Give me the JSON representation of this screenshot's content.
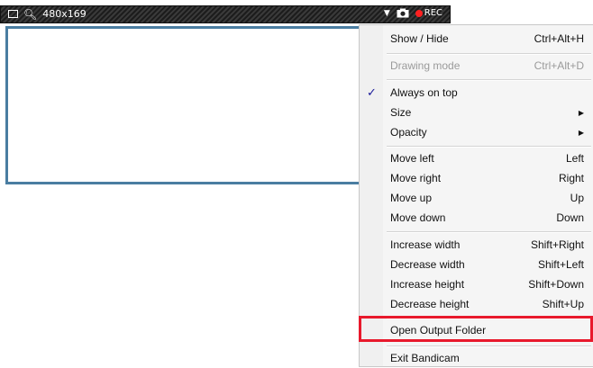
{
  "toolbar": {
    "size_label": "480x169",
    "rec_label": "REC",
    "icons": [
      "window-icon",
      "search-icon",
      "dropdown-arrow-icon",
      "camera-icon",
      "record-dot-icon"
    ]
  },
  "menu": {
    "show_hide": {
      "label": "Show / Hide",
      "shortcut": "Ctrl+Alt+H"
    },
    "drawing_mode": {
      "label": "Drawing mode",
      "shortcut": "Ctrl+Alt+D"
    },
    "always_on_top": {
      "label": "Always on top",
      "checked": true,
      "check": "✓"
    },
    "size": {
      "label": "Size",
      "arrow": "▶"
    },
    "opacity": {
      "label": "Opacity",
      "arrow": "▶"
    },
    "move_left": {
      "label": "Move left",
      "shortcut": "Left"
    },
    "move_right": {
      "label": "Move right",
      "shortcut": "Right"
    },
    "move_up": {
      "label": "Move up",
      "shortcut": "Up"
    },
    "move_down": {
      "label": "Move down",
      "shortcut": "Down"
    },
    "increase_width": {
      "label": "Increase width",
      "shortcut": "Shift+Right"
    },
    "decrease_width": {
      "label": "Decrease width",
      "shortcut": "Shift+Left"
    },
    "increase_height": {
      "label": "Increase height",
      "shortcut": "Shift+Down"
    },
    "decrease_height": {
      "label": "Decrease height",
      "shortcut": "Shift+Up"
    },
    "open_output_folder": {
      "label": "Open Output Folder"
    },
    "exit": {
      "label": "Exit Bandicam"
    }
  },
  "colors": {
    "capture_border": "#4a7da1",
    "highlight": "#e8192c",
    "rec_dot": "#ff2020"
  }
}
